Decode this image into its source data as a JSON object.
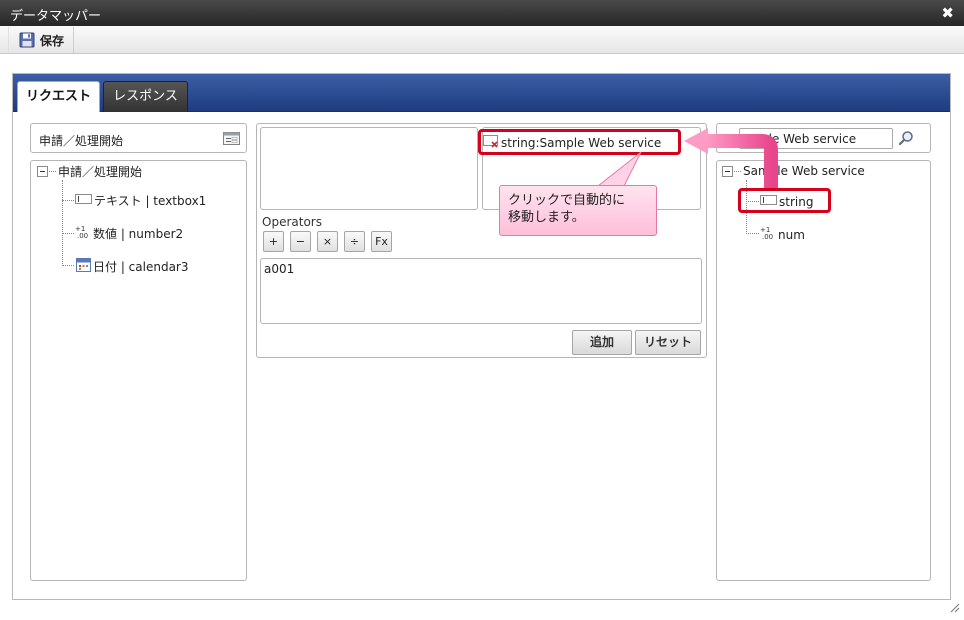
{
  "window": {
    "title": "データマッパー",
    "close_icon": "close-icon"
  },
  "toolbar": {
    "save_label": "保存",
    "save_icon": "floppy-disk-icon"
  },
  "tabs": [
    {
      "label": "リクエスト",
      "active": true
    },
    {
      "label": "レスポンス",
      "active": false
    }
  ],
  "left_panel": {
    "header_label": "申請／処理開始",
    "header_icon": "form-icon",
    "root_label": "申請／処理開始",
    "items": [
      {
        "label": "テキスト | textbox1",
        "icon": "textbox-icon"
      },
      {
        "label": "数値 | number2",
        "icon": "number-icon"
      },
      {
        "label": "日付 | calendar3",
        "icon": "calendar-icon"
      }
    ]
  },
  "middle_panel": {
    "target_item_label": "string:Sample Web service",
    "operators_label": "Operators",
    "operators": [
      "+",
      "−",
      "×",
      "÷",
      "Fx"
    ],
    "expression_value": "a001",
    "add_button": "追加",
    "reset_button": "リセット"
  },
  "right_panel": {
    "search_value": "ple Web service",
    "search_icon": "search-icon",
    "root_label": "Sample Web service",
    "items": [
      {
        "label": "string",
        "icon": "textbox-icon"
      },
      {
        "label": "num",
        "icon": "number-icon"
      }
    ]
  },
  "annotation": {
    "callout_text_line1": "クリックで自動的に",
    "callout_text_line2": "移動します。",
    "highlight_color": "#d4001c",
    "arrow_color": "#e8468c"
  }
}
